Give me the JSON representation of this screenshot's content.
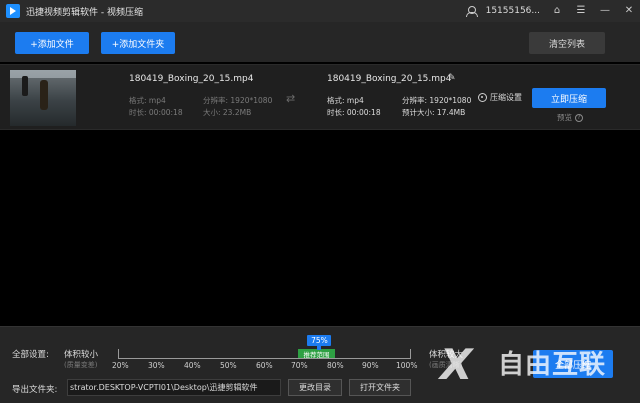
{
  "titlebar": {
    "app_title": "迅捷视频剪辑软件 - 视频压缩",
    "user_phone": "15155156...",
    "home_icon": "home-icon",
    "menu_icon": "menu-icon",
    "minimize_label": "—",
    "close_label": "✕"
  },
  "toolbar": {
    "add_file": "+添加文件",
    "add_folder": "+添加文件夹",
    "clear_list": "清空列表"
  },
  "file": {
    "source_name": "180419_Boxing_20_15.mp4",
    "source_format": "格式: mp4",
    "source_resolution": "分辨率: 1920*1080",
    "source_duration": "时长: 00:00:18",
    "source_size": "大小: 23.2MB",
    "output_name": "180419_Boxing_20_15.mp4",
    "output_format": "格式: mp4",
    "output_resolution": "分辨率: 1920*1080",
    "output_duration": "时长: 00:00:18",
    "output_size": "预计大小: 17.4MB",
    "settings_label": "压缩设置",
    "compress_now": "立即压缩",
    "preview_label": "预览"
  },
  "bottom": {
    "all_settings": "全部设置:",
    "smaller_label": "体积较小",
    "smaller_sub": "(质量变差)",
    "larger_label": "体积较大",
    "larger_sub": "(画质清晰)",
    "percent_badge": "75%",
    "recommend_label": "推荐范围",
    "ticks": [
      "20%",
      "30%",
      "40%",
      "50%",
      "60%",
      "70%",
      "80%",
      "90%",
      "100%"
    ],
    "compress_all": "全部压缩",
    "export_label": "导出文件夹:",
    "export_path": "strator.DESKTOP-VCPTI01\\Desktop\\迅捷剪辑软件",
    "change_dir": "更改目录",
    "open_folder": "打开文件夹"
  },
  "slider": {
    "value_percent": 75
  },
  "watermark": {
    "mark": "X",
    "text": "自由互联"
  },
  "colors": {
    "accent": "#1c7cf0",
    "recommend": "#2ea043",
    "background": "#000000",
    "panel": "#262626"
  }
}
